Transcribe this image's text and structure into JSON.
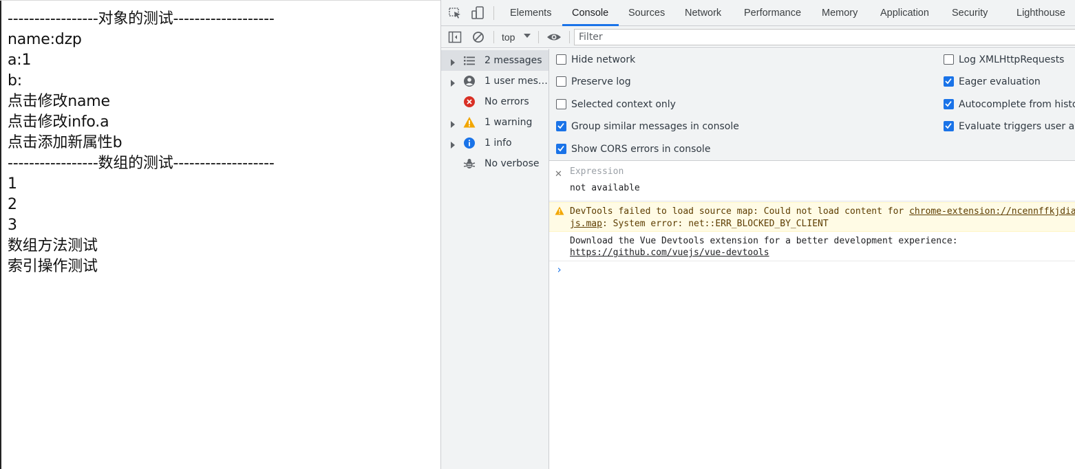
{
  "page": {
    "lines": [
      "-----------------对象的测试-------------------",
      "name:dzp",
      "a:1",
      "b:",
      "点击修改name",
      "点击修改info.a",
      "点击添加新属性b",
      "-----------------数组的测试-------------------",
      "1",
      "2",
      "3",
      "数组方法测试",
      "索引操作测试"
    ]
  },
  "devtools": {
    "tabs": [
      "Elements",
      "Console",
      "Sources",
      "Network",
      "Performance",
      "Memory",
      "Application",
      "Security",
      "Lighthouse"
    ],
    "active_tab": "Console",
    "toolbar": {
      "context": "top",
      "filter_placeholder": "Filter"
    },
    "sidebar": {
      "items": [
        {
          "label": "2 messages",
          "icon": "list-icon"
        },
        {
          "label": "1 user mess…",
          "icon": "user-icon"
        },
        {
          "label": "No errors",
          "icon": "error-icon"
        },
        {
          "label": "1 warning",
          "icon": "warning-icon"
        },
        {
          "label": "1 info",
          "icon": "info-icon"
        },
        {
          "label": "No verbose",
          "icon": "bug-icon"
        }
      ]
    },
    "settings": {
      "left": [
        {
          "label": "Hide network",
          "checked": false
        },
        {
          "label": "Preserve log",
          "checked": false
        },
        {
          "label": "Selected context only",
          "checked": false
        },
        {
          "label": "Group similar messages in console",
          "checked": true
        },
        {
          "label": "Show CORS errors in console",
          "checked": true
        }
      ],
      "right": [
        {
          "label": "Log XMLHttpRequests",
          "checked": false
        },
        {
          "label": "Eager evaluation",
          "checked": true
        },
        {
          "label": "Autocomplete from history",
          "checked": true
        },
        {
          "label": "Evaluate triggers user activation",
          "checked": true
        }
      ]
    },
    "expression": {
      "label": "Expression",
      "value": "not available"
    },
    "messages": {
      "warning": {
        "line1_text": "DevTools failed to load source map: Could not load content for ",
        "line1_link": "chrome-extension://ncennffkjdiamlpmcbajkmaiiiddgioo/js/xl-content.",
        "line2_link": "js.map",
        "line2_text": ": System error: net::ERR_BLOCKED_BY_CLIENT"
      },
      "info": {
        "line1": "Download the Vue Devtools extension for a better development experience:",
        "link": "https://github.com/vuejs/vue-devtools"
      }
    },
    "colors": {
      "accent": "#1a73e8",
      "warning_bg": "#fffbe5",
      "panel_bg": "#f1f3f4"
    }
  }
}
